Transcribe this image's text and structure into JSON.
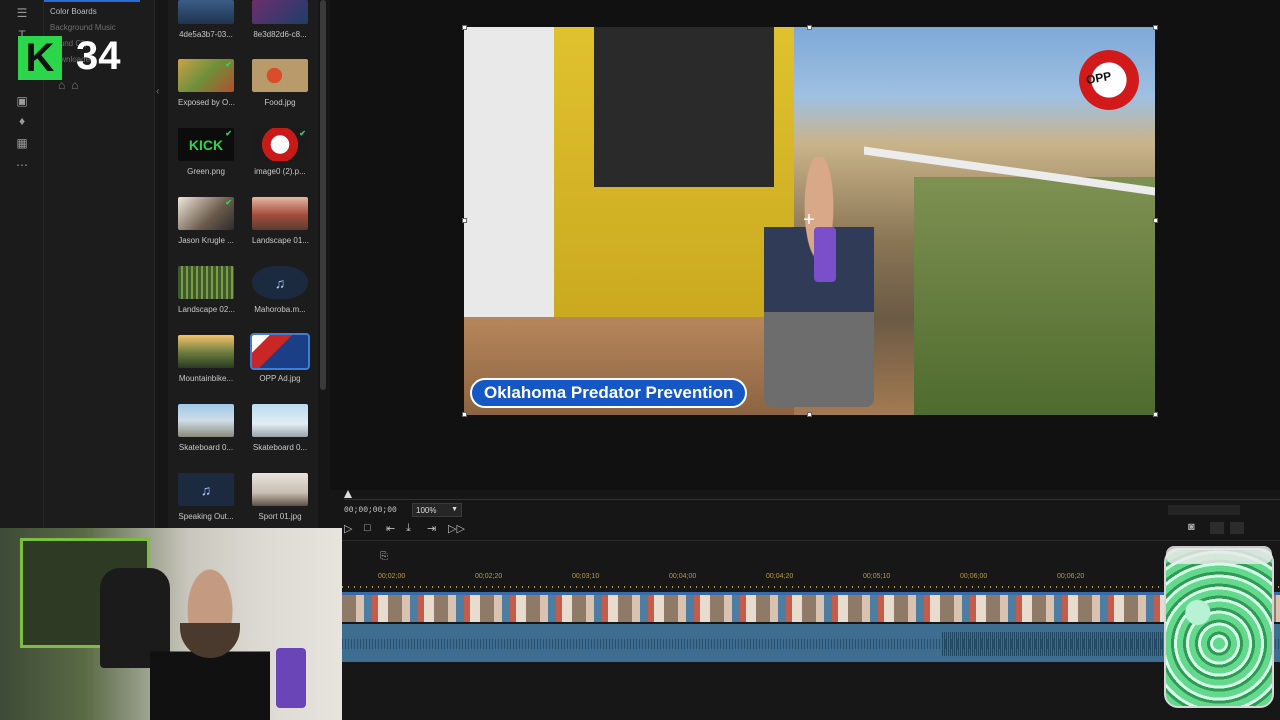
{
  "library": {
    "items": [
      "Color Boards",
      "Background Music",
      "Sound Clips",
      "Downloaded"
    ]
  },
  "media": [
    {
      "label": "4de5a3b7-03...",
      "type": "image",
      "checked": false
    },
    {
      "label": "8e3d82d6-c8...",
      "type": "image",
      "checked": false
    },
    {
      "label": "Exposed by O...",
      "type": "image",
      "checked": true
    },
    {
      "label": "Food.jpg",
      "type": "image",
      "checked": false
    },
    {
      "label": "Green.png",
      "type": "image",
      "checked": true
    },
    {
      "label": "image0 (2).p...",
      "type": "image",
      "checked": true
    },
    {
      "label": "Jason Krugle ...",
      "type": "image",
      "checked": true
    },
    {
      "label": "Landscape 01...",
      "type": "image",
      "checked": false
    },
    {
      "label": "Landscape 02...",
      "type": "image",
      "checked": false
    },
    {
      "label": "Mahoroba.m...",
      "type": "audio",
      "checked": false
    },
    {
      "label": "Mountainbike...",
      "type": "video",
      "checked": false
    },
    {
      "label": "OPP Ad.jpg",
      "type": "image",
      "checked": false
    },
    {
      "label": "Skateboard 0...",
      "type": "video",
      "checked": false
    },
    {
      "label": "Skateboard 0...",
      "type": "video",
      "checked": false
    },
    {
      "label": "Speaking Out...",
      "type": "audio",
      "checked": false
    },
    {
      "label": "Sport 01.jpg",
      "type": "image",
      "checked": false
    }
  ],
  "preview": {
    "caption": "Oklahoma Predator Prevention",
    "sticker_text": "OPP",
    "timecode": "00;00;00;00",
    "zoom": "100%"
  },
  "timeline": {
    "ruler": [
      "00;02;00",
      "00;02;20",
      "00;03;10",
      "00;04;00",
      "00;04;20",
      "00;05;10",
      "00;06;00",
      "00;06;20"
    ]
  },
  "overlay": {
    "logo_letter": "K",
    "logo_number": "34"
  }
}
